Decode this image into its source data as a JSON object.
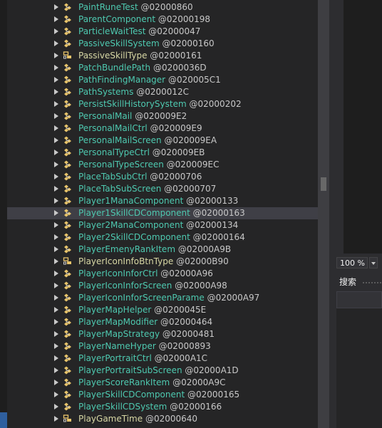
{
  "tree": {
    "items": [
      {
        "name": "PaintRuneTest",
        "token": "@02000860",
        "kind": "class"
      },
      {
        "name": "ParentComponent",
        "token": "@02000198",
        "kind": "class"
      },
      {
        "name": "ParticleWaitTest",
        "token": "@02000047",
        "kind": "class"
      },
      {
        "name": "PassiveSkillSystem",
        "token": "@02000160",
        "kind": "class"
      },
      {
        "name": "PassiveSkillType",
        "token": "@02000161",
        "kind": "enum"
      },
      {
        "name": "PatchBundlePath",
        "token": "@0200036D",
        "kind": "class"
      },
      {
        "name": "PathFindingManager",
        "token": "@020005C1",
        "kind": "class"
      },
      {
        "name": "PathSystems",
        "token": "@0200012C",
        "kind": "class"
      },
      {
        "name": "PersistSkillHistorySystem",
        "token": "@02000202",
        "kind": "class"
      },
      {
        "name": "PersonalMail",
        "token": "@020009E2",
        "kind": "class"
      },
      {
        "name": "PersonalMailCtrl",
        "token": "@020009E9",
        "kind": "class"
      },
      {
        "name": "PersonalMailScreen",
        "token": "@020009EA",
        "kind": "class"
      },
      {
        "name": "PersonalTypeCtrl",
        "token": "@020009EB",
        "kind": "class"
      },
      {
        "name": "PersonalTypeScreen",
        "token": "@020009EC",
        "kind": "class"
      },
      {
        "name": "PlaceTabSubCtrl",
        "token": "@02000706",
        "kind": "class"
      },
      {
        "name": "PlaceTabSubScreen",
        "token": "@02000707",
        "kind": "class"
      },
      {
        "name": "Player1ManaComponent",
        "token": "@02000133",
        "kind": "class"
      },
      {
        "name": "Player1SkillCDComponent",
        "token": "@02000163",
        "kind": "class",
        "selected": true
      },
      {
        "name": "Player2ManaComponent",
        "token": "@02000134",
        "kind": "class"
      },
      {
        "name": "Player2SkillCDComponent",
        "token": "@02000164",
        "kind": "class"
      },
      {
        "name": "PlayerEmenyRankItem",
        "token": "@02000A9B",
        "kind": "class"
      },
      {
        "name": "PlayerIconInfoBtnType",
        "token": "@02000B90",
        "kind": "enum"
      },
      {
        "name": "PlayerIconInforCtrl",
        "token": "@02000A96",
        "kind": "class"
      },
      {
        "name": "PlayerIconInforScreen",
        "token": "@02000A98",
        "kind": "class"
      },
      {
        "name": "PlayerIconInforScreenParame",
        "token": "@02000A97",
        "kind": "class"
      },
      {
        "name": "PlayerMapHelper",
        "token": "@0200045E",
        "kind": "class"
      },
      {
        "name": "PlayerMapModifier",
        "token": "@02000464",
        "kind": "class"
      },
      {
        "name": "PlayerMapStrategy",
        "token": "@02000481",
        "kind": "class"
      },
      {
        "name": "PlayerNameHyper",
        "token": "@02000893",
        "kind": "class"
      },
      {
        "name": "PlayerPortraitCtrl",
        "token": "@02000A1C",
        "kind": "class"
      },
      {
        "name": "PlayerPortraitSubScreen",
        "token": "@02000A1D",
        "kind": "class"
      },
      {
        "name": "PlayerScoreRankItem",
        "token": "@02000A9C",
        "kind": "class"
      },
      {
        "name": "PlayerSkillCDComponent",
        "token": "@02000165",
        "kind": "class"
      },
      {
        "name": "PlayerSkillCDSystem",
        "token": "@02000166",
        "kind": "class"
      },
      {
        "name": "PlayGameTime",
        "token": "@02000640",
        "kind": "enum"
      }
    ]
  },
  "zoom": {
    "value": "100 %"
  },
  "search_panel": {
    "title": "搜索"
  },
  "colors": {
    "type_name": "#4ec9b0",
    "value_type_name": "#d7d7a4",
    "token": "#c8c8c8",
    "selection": "#3f3f46"
  }
}
